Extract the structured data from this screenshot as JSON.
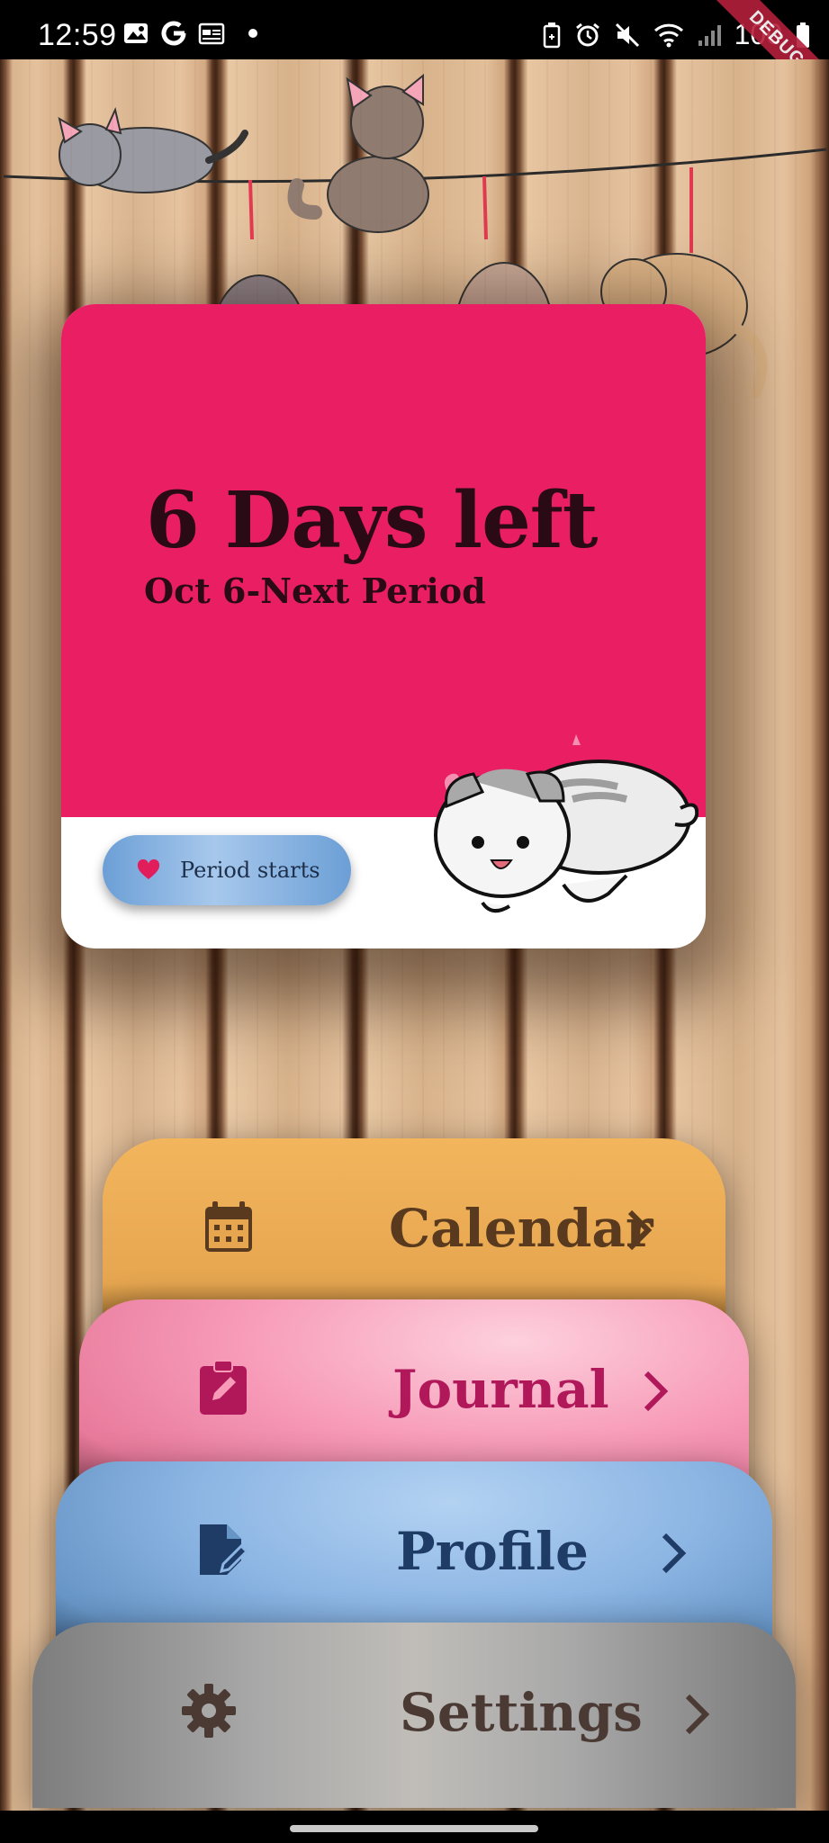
{
  "status_bar": {
    "time": "12:59",
    "battery": "100",
    "left_icons": [
      "image-icon",
      "google-icon",
      "calendar-news-icon",
      "dot-icon"
    ],
    "right_icons": [
      "battery-saver-icon",
      "alarm-icon",
      "mute-icon",
      "wifi-icon",
      "signal-icon",
      "battery-icon"
    ]
  },
  "debug_banner": "DEBUG",
  "countdown_card": {
    "days_left": "6 Days left",
    "next_period": "Oct 6-Next Period",
    "period_button_label": "Period starts",
    "accent_color": "#ea1f63"
  },
  "menu": {
    "calendar": {
      "label": "Calendar",
      "icon": "calendar-icon",
      "color": "#f2b55c",
      "text_color": "#5a3a1e"
    },
    "journal": {
      "label": "Journal",
      "icon": "edit-clipboard-icon",
      "color": "#f79bb8",
      "text_color": "#b0185a"
    },
    "profile": {
      "label": "Profile",
      "icon": "edit-document-icon",
      "color": "#8db6e4",
      "text_color": "#1f3c66"
    },
    "settings": {
      "label": "Settings",
      "icon": "gear-icon",
      "color": "#a9a9a9",
      "text_color": "#4a3a33"
    }
  }
}
